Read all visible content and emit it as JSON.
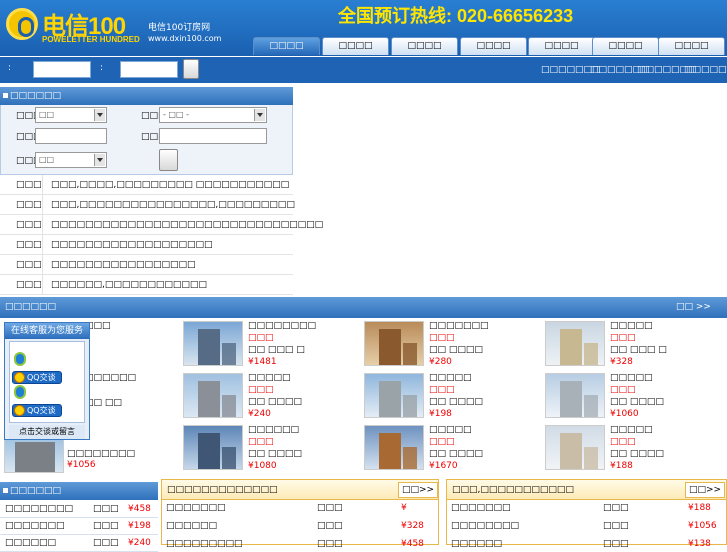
{
  "header": {
    "logo_text": "电信100",
    "logo_sub": "POWELETTER HUNDRED",
    "site_name": "电信100订房网",
    "site_url": "www.dxin100.com",
    "hotline": "全国预订热线: 020-66656233"
  },
  "nav": {
    "tabs": [
      "□□□□",
      "□□□□",
      "□□□□",
      "□□□□",
      "□□□□",
      "□□□□",
      "□□□□"
    ]
  },
  "search_bar": {
    "colon1": ":",
    "colon2": ":",
    "links": [
      "□□□□□□□",
      "□□□□□□□",
      "□□□□□□□",
      "□□□□□□□"
    ]
  },
  "search_box": {
    "title": "□□□□□□",
    "city_label": "□□□",
    "city_value": "□□",
    "district_label": "□□□",
    "district_value": "- □□ -",
    "checkin_label": "□□□",
    "checkout_label": "□□□",
    "star_label": "□□□",
    "star_value": "□□"
  },
  "info_list": [
    {
      "cat": "□□□",
      "text": "□□□,□□□□,□□□□□□□□□ □□□□□□□□□□□"
    },
    {
      "cat": "□□□",
      "text": "□□□,□□□□□□□□□□□□□□□□,□□□□□□□□□"
    },
    {
      "cat": "□□□",
      "text": "□□□□□□□□□□□□□□□□□□□□□□□□□□□□□□□□"
    },
    {
      "cat": "□□□",
      "text": "□□□□□□□□□□□□□□□□□□□"
    },
    {
      "cat": "□□□",
      "text": "□□□□□□□□□□□□□□□□□"
    },
    {
      "cat": "□□□",
      "text": "□□□□□□,□□□□□□□□□□□□"
    }
  ],
  "hot_hotels": {
    "title": "□□□□□□",
    "more": "□□ >>",
    "col0_names": [
      "□□□",
      "□□□□□□",
      "□□ □□",
      "□□□□□□□□"
    ],
    "col0_price": "¥1056",
    "hotels": [
      {
        "name": "□□□□□□□□",
        "star": "□□□",
        "area": "□□ □□□ □",
        "price": "¥1481"
      },
      {
        "name": "□□□□□□□",
        "star": "□□□",
        "area": "□□ □□□□",
        "price": "¥280"
      },
      {
        "name": "□□□□□",
        "star": "□□□",
        "area": "□□ □□□ □",
        "price": "¥328"
      },
      {
        "name": "□□□□□",
        "star": "□□□",
        "area": "□□ □□□□",
        "price": "¥240"
      },
      {
        "name": "□□□□□",
        "star": "□□□",
        "area": "□□ □□□□",
        "price": "¥198"
      },
      {
        "name": "□□□□□",
        "star": "□□□",
        "area": "□□ □□□□",
        "price": "¥1060"
      },
      {
        "name": "□□□□□□",
        "star": "□□□",
        "area": "□□ □□□□",
        "price": "¥1080"
      },
      {
        "name": "□□□□□",
        "star": "□□□",
        "area": "□□ □□□□",
        "price": "¥1670"
      },
      {
        "name": "□□□□□",
        "star": "□□□",
        "area": "□□ □□□□",
        "price": "¥188"
      }
    ]
  },
  "chat_widget": {
    "title": "在线客服为您服务",
    "qq_label": "QQ交谈",
    "leave_message": "点击交谈或留言"
  },
  "bottom_left": {
    "title": "□□□□□□",
    "rows": [
      {
        "name": "□□□□□□□□",
        "star": "□□□",
        "price": "¥458"
      },
      {
        "name": "□□□□□□□",
        "star": "□□□",
        "price": "¥198"
      },
      {
        "name": "□□□□□□",
        "star": "□□□",
        "price": "¥240"
      }
    ]
  },
  "panel_mid": {
    "title": "□□□□□□□□□□□□□",
    "more": "□□>>",
    "rows": [
      {
        "name": "□□□□□□□",
        "star": "□□□",
        "price": "¥"
      },
      {
        "name": "□□□□□□",
        "star": "□□□",
        "price": "¥328"
      },
      {
        "name": "□□□□□□□□□",
        "star": "□□□",
        "price": "¥458"
      }
    ]
  },
  "panel_right": {
    "title": "□□□,□□□□□□□□□□□",
    "more": "□□>>",
    "rows": [
      {
        "name": "□□□□□□□",
        "star": "□□□",
        "price": "¥188"
      },
      {
        "name": "□□□□□□□□",
        "star": "□□□",
        "price": "¥1056"
      },
      {
        "name": "□□□□□□",
        "star": "□□□",
        "price": "¥138"
      }
    ]
  },
  "colors": {
    "brand_blue": "#1e63b4",
    "accent_yellow": "#ffd400",
    "price_red": "#e00000",
    "panel_border": "#e8b84a"
  }
}
